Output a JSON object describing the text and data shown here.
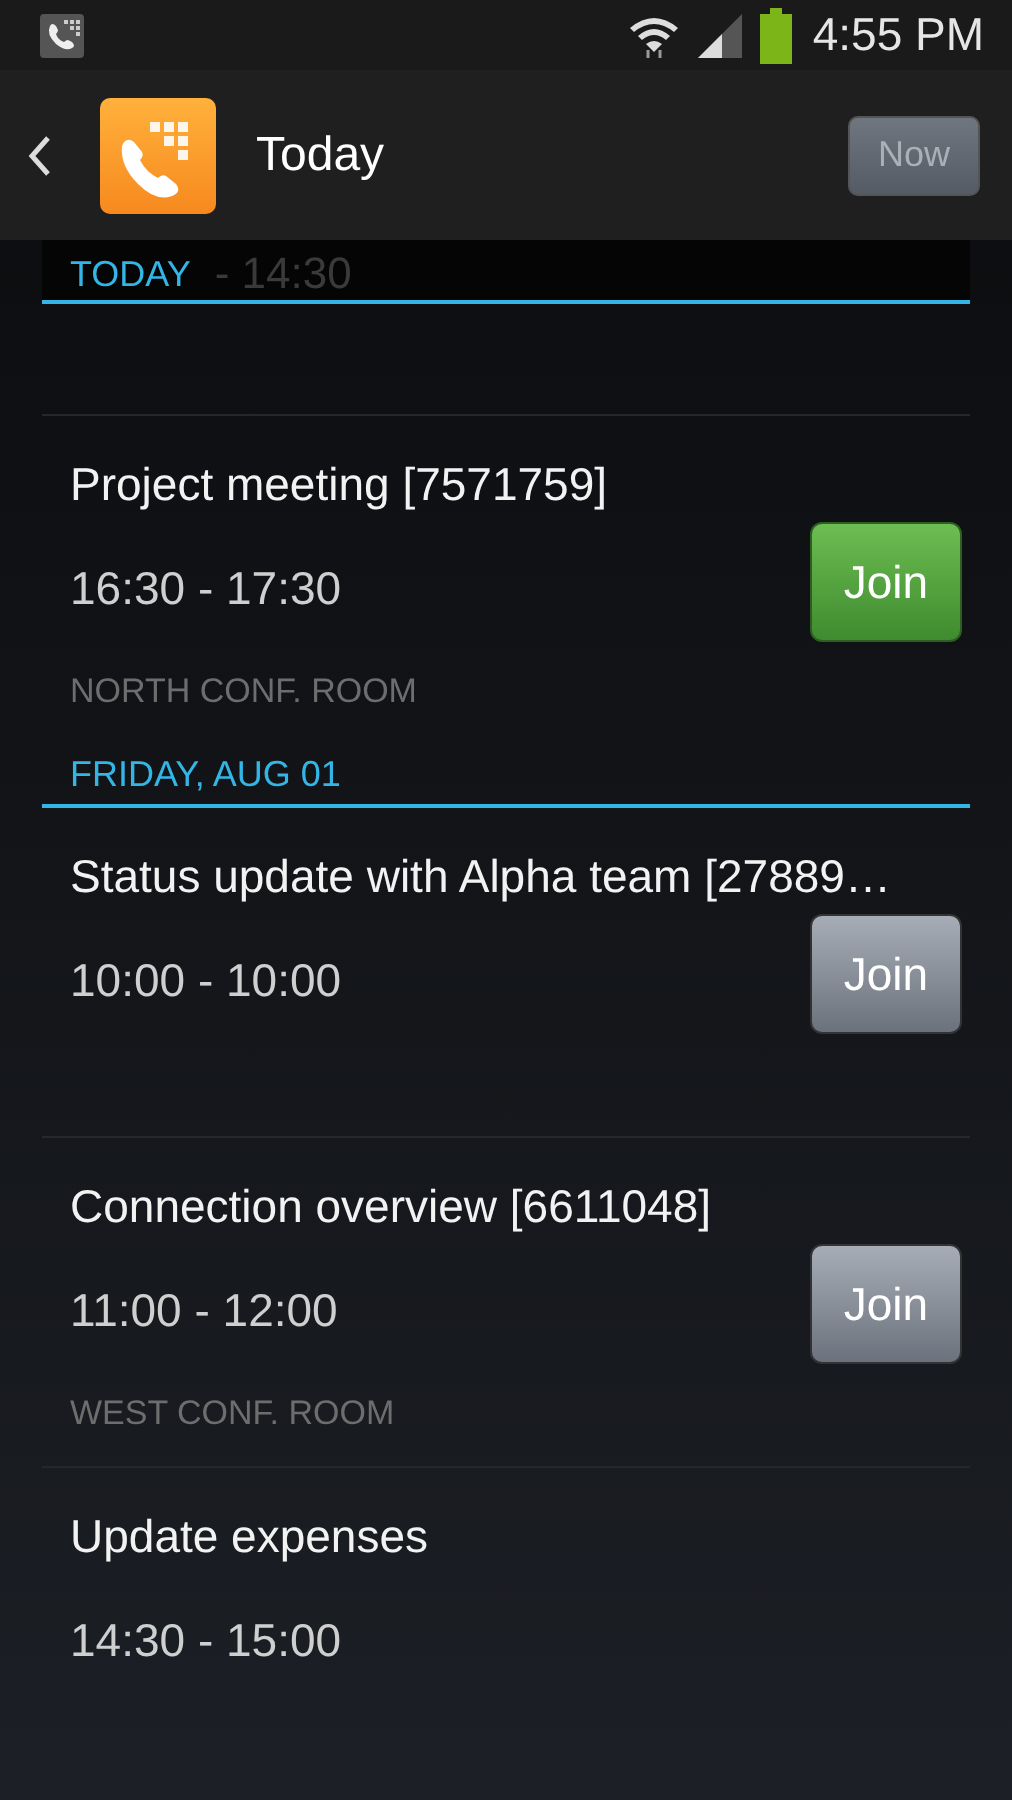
{
  "status_bar": {
    "time": "4:55 PM"
  },
  "action_bar": {
    "title": "Today",
    "now_button": {
      "label": "Now",
      "enabled": false
    }
  },
  "pinned_header": {
    "label": "TODAY",
    "scrolled_time": "- 14:30"
  },
  "sections": [
    {
      "meetings": [
        {
          "title": "Project meeting [7571759]",
          "time": "16:30 - 17:30",
          "location": "NORTH CONF. ROOM",
          "join_button": {
            "label": "Join",
            "active": true
          }
        }
      ]
    },
    {
      "header": "FRIDAY, AUG 01",
      "meetings": [
        {
          "title": "Status update with Alpha team [27889…",
          "time": "10:00 - 10:00",
          "join_button": {
            "label": "Join",
            "active": false
          }
        },
        {
          "title": "Connection overview [6611048]",
          "time": "11:00 - 12:00",
          "location": "WEST CONF. ROOM",
          "join_button": {
            "label": "Join",
            "active": false
          }
        },
        {
          "title": "Update expenses",
          "time": "14:30 - 15:00"
        }
      ]
    }
  ]
}
